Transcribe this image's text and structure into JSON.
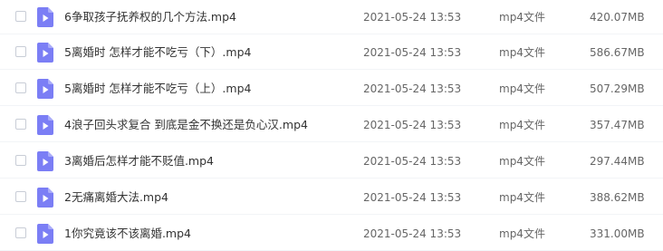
{
  "icon_color": "#7b7ef5",
  "files": [
    {
      "name": "6争取孩子抚养权的几个方法.mp4",
      "date": "2021-05-24 13:53",
      "type": "mp4文件",
      "size": "420.07MB",
      "icon": "video-file-icon"
    },
    {
      "name": "5离婚时 怎样才能不吃亏（下）.mp4",
      "date": "2021-05-24 13:53",
      "type": "mp4文件",
      "size": "586.67MB",
      "icon": "video-file-icon"
    },
    {
      "name": "5离婚时 怎样才能不吃亏（上）.mp4",
      "date": "2021-05-24 13:53",
      "type": "mp4文件",
      "size": "507.29MB",
      "icon": "video-file-icon"
    },
    {
      "name": "4浪子回头求复合 到底是金不换还是负心汉.mp4",
      "date": "2021-05-24 13:53",
      "type": "mp4文件",
      "size": "357.47MB",
      "icon": "video-file-icon"
    },
    {
      "name": "3离婚后怎样才能不贬值.mp4",
      "date": "2021-05-24 13:53",
      "type": "mp4文件",
      "size": "297.44MB",
      "icon": "video-file-icon"
    },
    {
      "name": "2无痛离婚大法.mp4",
      "date": "2021-05-24 13:53",
      "type": "mp4文件",
      "size": "388.62MB",
      "icon": "video-file-icon"
    },
    {
      "name": "1你究竟该不该离婚.mp4",
      "date": "2021-05-24 13:53",
      "type": "mp4文件",
      "size": "331.00MB",
      "icon": "video-file-icon"
    }
  ]
}
